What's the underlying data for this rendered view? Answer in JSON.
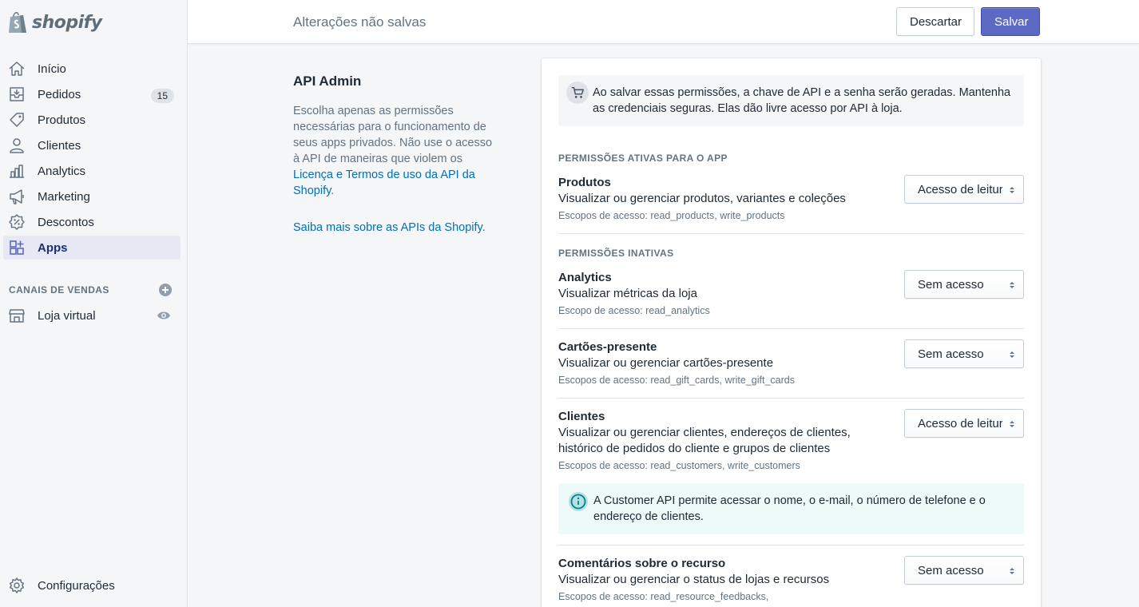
{
  "brand": {
    "name": "shopify"
  },
  "sidebar": {
    "items": [
      {
        "label": "Início",
        "icon": "home-icon"
      },
      {
        "label": "Pedidos",
        "icon": "orders-icon",
        "badge": "15"
      },
      {
        "label": "Produtos",
        "icon": "tag-icon"
      },
      {
        "label": "Clientes",
        "icon": "person-icon"
      },
      {
        "label": "Analytics",
        "icon": "bar-chart-icon"
      },
      {
        "label": "Marketing",
        "icon": "megaphone-icon"
      },
      {
        "label": "Descontos",
        "icon": "discount-icon"
      },
      {
        "label": "Apps",
        "icon": "apps-icon",
        "active": true
      }
    ],
    "sales_channels_title": "CANAIS DE VENDAS",
    "store_label": "Loja virtual",
    "settings_label": "Configurações"
  },
  "topbar": {
    "title": "Alterações não salvas",
    "discard_label": "Descartar",
    "save_label": "Salvar",
    "save_color": "#5c6ac4"
  },
  "description": {
    "title": "API Admin",
    "text_before": "Escolha apenas as permissões necessárias para o funcionamento de seus apps privados. Não use o acesso à API de maneiras que violem os ",
    "terms_link": "Licença e Termos de uso da API da Shopify",
    "text_after": ".",
    "learn_more_link": "Saiba mais sobre as APIs da Shopify",
    "learn_more_after": "."
  },
  "notice": {
    "icon": "store-key-icon",
    "text": "Ao salvar essas permissões, a chave de API e a senha serão geradas. Mantenha as credenciais seguras. Elas dão livre acesso por API à loja."
  },
  "active_group_title": "PERMISSÕES ATIVAS PARA O APP",
  "inactive_group_title": "PERMISSÕES INATIVAS",
  "permissions": [
    {
      "name": "Produtos",
      "desc": "Visualizar ou gerenciar produtos, variantes e coleções",
      "scope": "Escopos de acesso: read_products, write_products",
      "value": "Acesso de leitura"
    },
    {
      "name": "Analytics",
      "desc": "Visualizar métricas da loja",
      "scope": "Escopo de acesso: read_analytics",
      "value": "Sem acesso"
    },
    {
      "name": "Cartões-presente",
      "desc": "Visualizar ou gerenciar cartões-presente",
      "scope": "Escopos de acesso: read_gift_cards, write_gift_cards",
      "value": "Sem acesso"
    },
    {
      "name": "Clientes",
      "desc": "Visualizar ou gerenciar clientes, endereços de clientes, histórico de pedidos do cliente e grupos de clientes",
      "scope": "Escopos de acesso: read_customers, write_customers",
      "value": "Acesso de leitura"
    },
    {
      "name": "Comentários sobre o recurso",
      "desc": "Visualizar ou gerenciar o status de lojas e recursos",
      "scope": "Escopos de acesso: read_resource_feedbacks,",
      "value": "Sem acesso"
    }
  ],
  "info_banner": {
    "icon": "info-icon",
    "text": "A Customer API permite acessar o nome, o e-mail, o número de telefone e o endereço de clientes."
  }
}
